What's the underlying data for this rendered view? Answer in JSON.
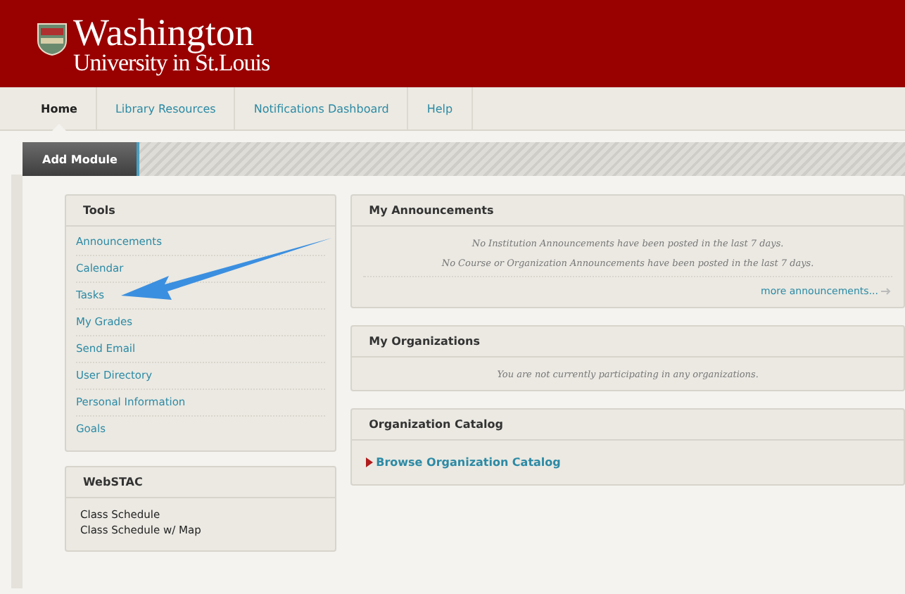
{
  "header": {
    "logo_line1": "Washington",
    "logo_line2": "University in St.Louis"
  },
  "tabs": [
    {
      "label": "Home",
      "selected": true
    },
    {
      "label": "Library Resources",
      "selected": false
    },
    {
      "label": "Notifications Dashboard",
      "selected": false
    },
    {
      "label": "Help",
      "selected": false
    }
  ],
  "add_module": "Add Module",
  "left_modules": [
    {
      "title": "Tools",
      "kind": "links",
      "items": [
        "Announcements",
        "Calendar",
        "Tasks",
        "My Grades",
        "Send Email",
        "User Directory",
        "Personal Information",
        "Goals"
      ]
    },
    {
      "title": "WebSTAC",
      "kind": "plain",
      "items": [
        "Class Schedule",
        "Class Schedule w/ Map"
      ]
    }
  ],
  "right_modules": [
    {
      "title": "My Announcements",
      "kind": "notes",
      "notes": [
        "No Institution Announcements have been posted in the last 7 days.",
        "No Course or Organization Announcements have been posted in the last 7 days."
      ],
      "more_link": "more announcements..."
    },
    {
      "title": "My Organizations",
      "kind": "notes",
      "notes": [
        "You are not currently participating in any organizations."
      ]
    },
    {
      "title": "Organization Catalog",
      "kind": "link",
      "link": "Browse Organization Catalog"
    }
  ]
}
